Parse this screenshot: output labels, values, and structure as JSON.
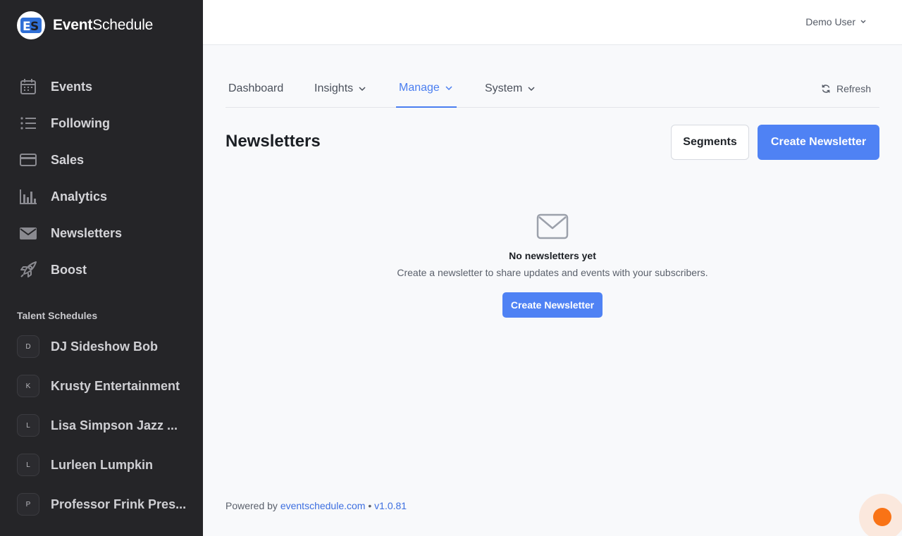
{
  "brand": {
    "name_bold": "Event",
    "name_rest": "Schedule"
  },
  "sidebar": {
    "nav": [
      {
        "label": "Events",
        "icon": "calendar-icon"
      },
      {
        "label": "Following",
        "icon": "list-icon"
      },
      {
        "label": "Sales",
        "icon": "credit-card-icon"
      },
      {
        "label": "Analytics",
        "icon": "bar-chart-icon"
      },
      {
        "label": "Newsletters",
        "icon": "envelope-icon"
      },
      {
        "label": "Boost",
        "icon": "rocket-icon"
      }
    ],
    "section_title": "Talent Schedules",
    "talents": [
      {
        "initial": "D",
        "label": "DJ Sideshow Bob"
      },
      {
        "initial": "K",
        "label": "Krusty Entertainment"
      },
      {
        "initial": "L",
        "label": "Lisa Simpson Jazz ..."
      },
      {
        "initial": "L",
        "label": "Lurleen Lumpkin"
      },
      {
        "initial": "P",
        "label": "Professor Frink Pres..."
      }
    ]
  },
  "header": {
    "user": "Demo User"
  },
  "tabs": [
    {
      "label": "Dashboard",
      "dropdown": false
    },
    {
      "label": "Insights",
      "dropdown": true
    },
    {
      "label": "Manage",
      "dropdown": true,
      "active": true
    },
    {
      "label": "System",
      "dropdown": true
    }
  ],
  "refresh_label": "Refresh",
  "page": {
    "title": "Newsletters",
    "segments_label": "Segments",
    "create_label": "Create Newsletter"
  },
  "empty_state": {
    "title": "No newsletters yet",
    "description": "Create a newsletter to share updates and events with your subscribers.",
    "button": "Create Newsletter"
  },
  "footer": {
    "powered_by": "Powered by",
    "link": "eventschedule.com",
    "separator": "•",
    "version": "v1.0.81"
  },
  "colors": {
    "accent": "#4f82f4",
    "sidebar_bg": "#252528",
    "chat_bubble": "#f97316"
  }
}
